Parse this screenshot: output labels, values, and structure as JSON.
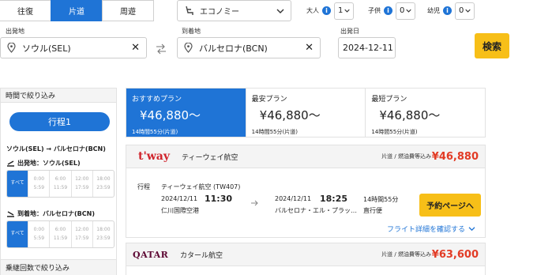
{
  "search": {
    "trip_types": [
      "往復",
      "片道",
      "周遊"
    ],
    "active_trip": 1,
    "cabin": "エコノミー",
    "adults_label": "大人",
    "adults_value": "1",
    "children_label": "子供",
    "children_value": "0",
    "infants_label": "幼児",
    "infants_value": "0",
    "origin_label": "出発地",
    "origin_value": "ソウル(SEL)",
    "destination_label": "到着地",
    "destination_value": "バルセロナ(BCN)",
    "date_label": "出発日",
    "date_value": "2024-12-11",
    "search_button": "検索"
  },
  "filters": {
    "time_header": "時間で絞り込み",
    "leg_button": "行程1",
    "route": "ソウル(SEL) → バルセロナ(BCN)",
    "departure_label": "出発地：ソウル(SEL)",
    "arrival_label": "到着地：バルセロナ(BCN)",
    "slots": [
      {
        "top": "すべて",
        "bottom": ""
      },
      {
        "top": "0:00",
        "bottom": "5:59"
      },
      {
        "top": "6:00",
        "bottom": "11:59"
      },
      {
        "top": "12:00",
        "bottom": "17:59"
      },
      {
        "top": "18:00",
        "bottom": "23:59"
      }
    ],
    "stops_header": "乗継回数で絞り込み"
  },
  "plans": [
    {
      "title": "おすすめプラン",
      "price": "¥46,880～",
      "meta": "14時間55分(片道)"
    },
    {
      "title": "最安プラン",
      "price": "¥46,880～",
      "meta": "14時間55分(片道)"
    },
    {
      "title": "最短プラン",
      "price": "¥46,880～",
      "meta": "14時間55分(片道)"
    }
  ],
  "results": [
    {
      "logo": "t'way",
      "airline": "ティーウェイ航空",
      "note": "片道 / 燃油費等込み",
      "price": "¥46,880",
      "leg_label": "行程",
      "carrier": "ティーウェイ航空 (TW407)",
      "dep_date": "2024/12/11",
      "dep_time": "11:30",
      "dep_airport": "仁川国際空港",
      "arr_date": "2024/12/11",
      "arr_time": "18:25",
      "arr_airport": "バルセロナ・エル・プラッ…",
      "duration": "14時間55分",
      "stops": "直行便",
      "book_button": "予約ページへ",
      "details_link": "フライト詳細を確認する"
    },
    {
      "logo": "QATAR",
      "airline": "カタール航空",
      "note": "片道 / 燃油費等込み",
      "price": "¥63,600"
    }
  ],
  "colors": {
    "accent": "#1f74d6",
    "cta": "#f7bf18",
    "price": "#e23b25"
  }
}
